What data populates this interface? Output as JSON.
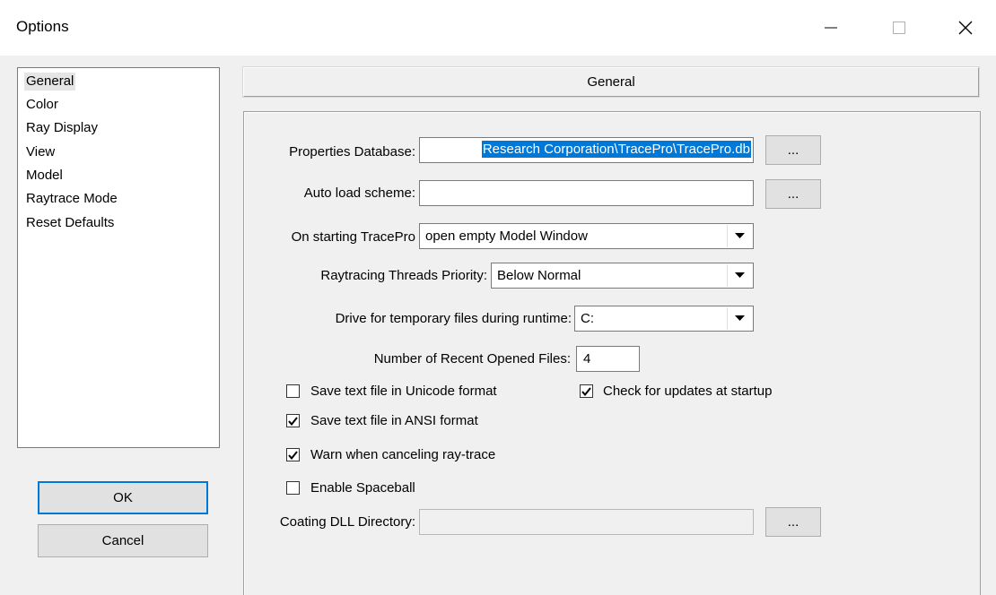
{
  "window": {
    "title": "Options",
    "minimize_glyph": "—",
    "close_glyph": "✕"
  },
  "categories": {
    "items": [
      {
        "label": "General"
      },
      {
        "label": "Color"
      },
      {
        "label": "Ray Display"
      },
      {
        "label": "View"
      },
      {
        "label": "Model"
      },
      {
        "label": "Raytrace Mode"
      },
      {
        "label": "Reset Defaults"
      }
    ],
    "selected": "General"
  },
  "buttons": {
    "ok": "OK",
    "cancel": "Cancel",
    "browse": "..."
  },
  "general": {
    "header": "General",
    "properties_db": {
      "label": "Properties Database:",
      "value": "Research Corporation\\TracePro\\TracePro.db"
    },
    "auto_load": {
      "label": "Auto load scheme:",
      "value": ""
    },
    "on_start": {
      "label": "On starting TracePro",
      "value": "open empty Model Window"
    },
    "thread_priority": {
      "label": "Raytracing Threads Priority:",
      "value": "Below Normal"
    },
    "temp_drive": {
      "label": "Drive for temporary files during runtime:",
      "value": "C:"
    },
    "recent_files": {
      "label": "Number of Recent Opened Files:",
      "value": "4"
    },
    "checkboxes": {
      "unicode": {
        "label": "Save text file in Unicode format",
        "checked": false
      },
      "updates": {
        "label": "Check for updates at startup",
        "checked": true
      },
      "ansi": {
        "label": "Save text file in ANSI format",
        "checked": true
      },
      "warn_cancel": {
        "label": "Warn when canceling ray-trace",
        "checked": true
      },
      "spaceball": {
        "label": "Enable Spaceball",
        "checked": false
      }
    },
    "coating_dll": {
      "label": "Coating DLL Directory:",
      "value": ""
    }
  },
  "colors": {
    "selection": "#0078d7",
    "dialog_bg": "#f0f0f0"
  }
}
